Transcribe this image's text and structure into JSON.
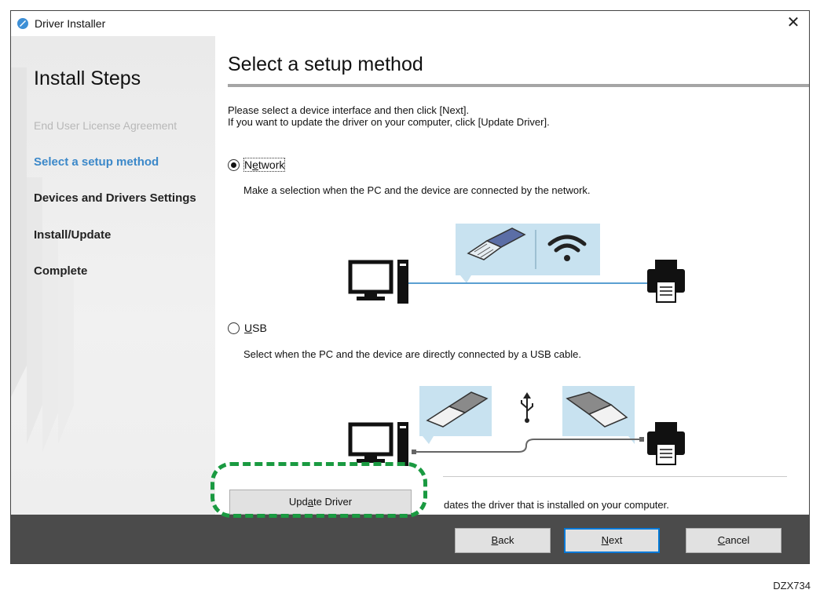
{
  "window": {
    "title": "Driver Installer",
    "close_label": "✕"
  },
  "sidebar": {
    "heading": "Install Steps",
    "steps": [
      {
        "label": "End User License Agreement",
        "state": "done"
      },
      {
        "label": "Select a setup method",
        "state": "active"
      },
      {
        "label": "Devices and Drivers Settings",
        "state": "pending"
      },
      {
        "label": "Install/Update",
        "state": "pending"
      },
      {
        "label": "Complete",
        "state": "pending"
      }
    ]
  },
  "main": {
    "title": "Select a setup method",
    "intro_line1": "Please select a device interface and then click [Next].",
    "intro_line2": "If you want to update the driver on your computer, click [Update Driver].",
    "options": {
      "network": {
        "label_pre": "N",
        "label_mnemonic": "e",
        "label_post": "twork",
        "checked": true,
        "description": "Make a selection when the PC and the device are connected by the network."
      },
      "usb": {
        "label_pre": "",
        "label_mnemonic": "U",
        "label_post": "SB",
        "checked": false,
        "description": "Select when the PC and the device are directly connected by a USB cable."
      }
    },
    "update": {
      "button_pre": "Upd",
      "button_mnemonic": "a",
      "button_post": "te Driver",
      "description": "dates the driver that is installed on your computer."
    }
  },
  "footer": {
    "back": {
      "mnemonic": "B",
      "rest": "ack"
    },
    "next": {
      "mnemonic": "N",
      "rest": "ext"
    },
    "cancel": {
      "mnemonic": "C",
      "rest": "ancel"
    }
  },
  "doc_code": "DZX734",
  "colors": {
    "active_step": "#3b88c9",
    "footer_bg": "#4b4b4b",
    "highlight": "#1a9a41",
    "callout_bg": "#c8e2f0"
  }
}
